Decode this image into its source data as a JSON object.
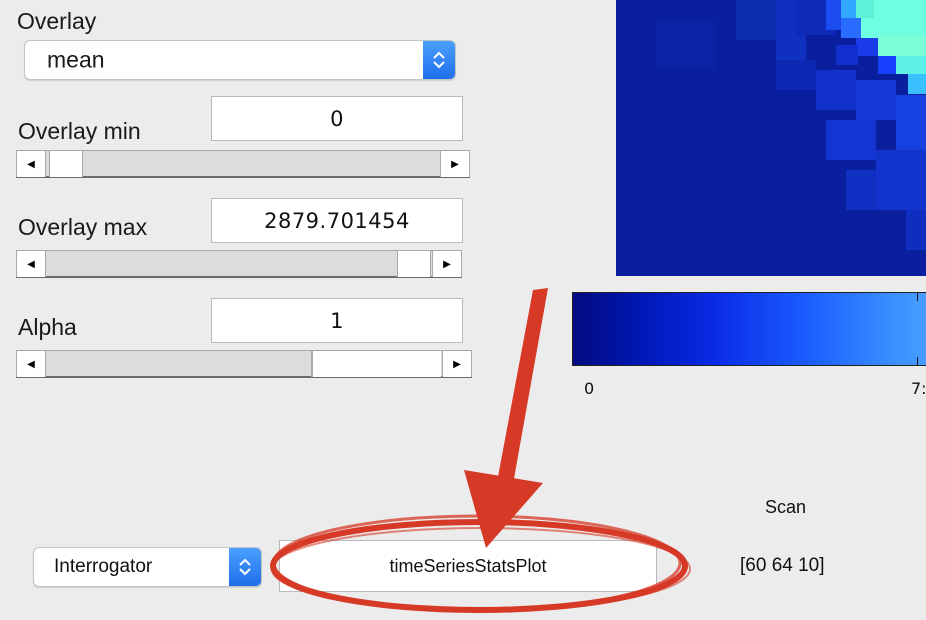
{
  "overlay": {
    "label": "Overlay",
    "selected": "mean"
  },
  "overlay_min": {
    "label": "Overlay min",
    "value": "0",
    "slider_fraction": 0.0
  },
  "overlay_max": {
    "label": "Overlay max",
    "value": "2879.701454",
    "slider_fraction": 1.0
  },
  "alpha": {
    "label": "Alpha",
    "value": "1",
    "slider_fraction": 0.67
  },
  "colorbar": {
    "tick_start": "0",
    "tick_partial": "7:"
  },
  "bottom": {
    "tool_selected": "Interrogator",
    "function_value": "timeSeriesStatsPlot",
    "scan_label": "Scan",
    "scan_dims": "[60 64 10]"
  },
  "colors": {
    "background": "#ececec",
    "stepper_blue": "#2a7cf5",
    "annotation_red": "#d63a26",
    "heatmap_dark": "#0a1f9e",
    "heatmap_hot": "#6fffe0"
  },
  "icons": {
    "popup_stepper": "up-down-chevron-icon",
    "slider_left": "left-arrow-icon",
    "slider_right": "right-arrow-icon",
    "annotation": "red-arrow-and-circle"
  }
}
